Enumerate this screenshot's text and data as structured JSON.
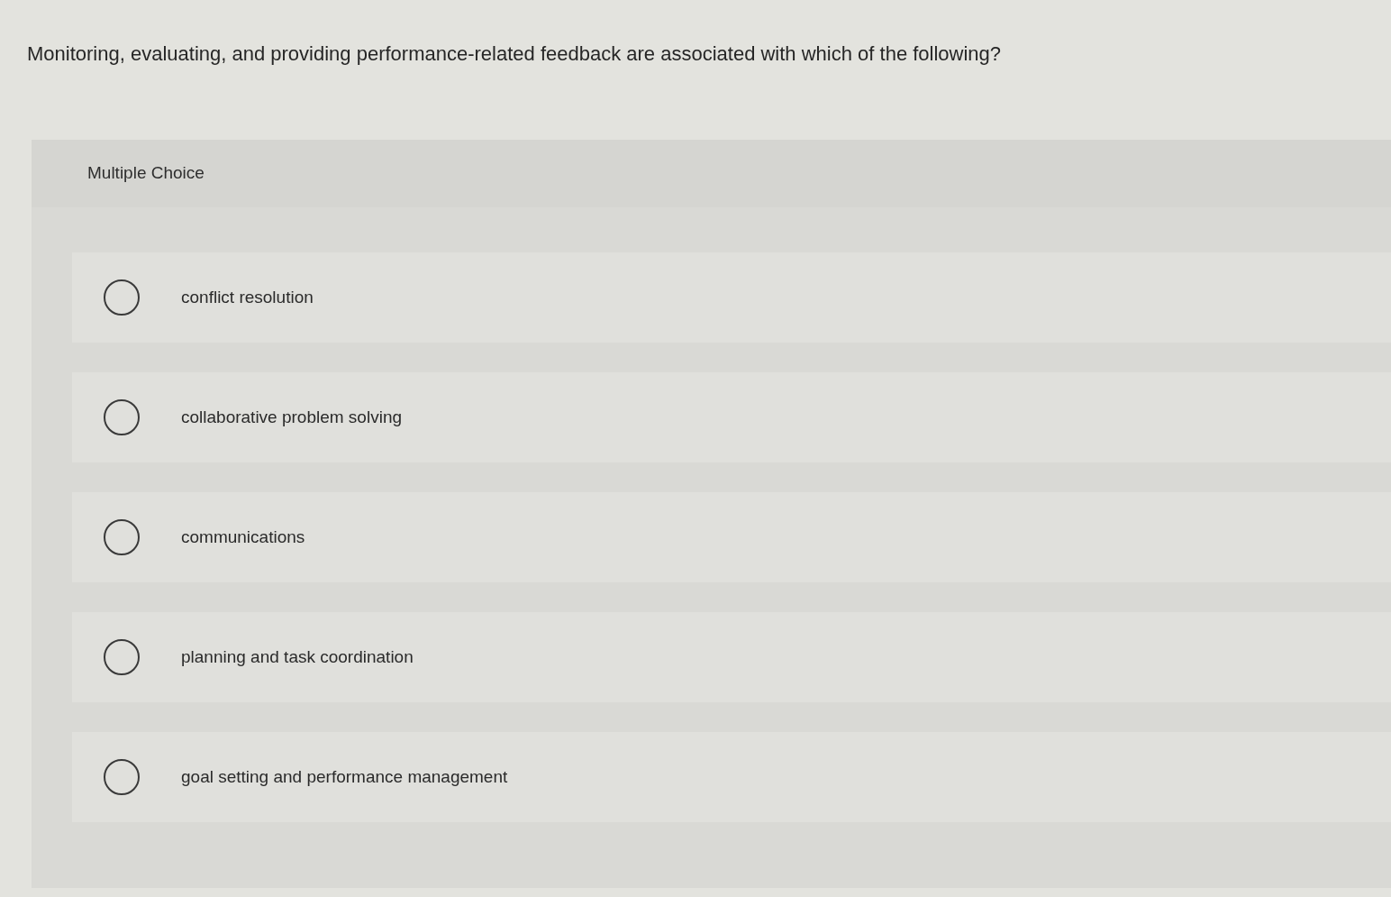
{
  "question": "Monitoring, evaluating, and providing performance-related feedback are associated with which of the following?",
  "panel": {
    "type_label": "Multiple Choice",
    "options": [
      {
        "label": "conflict resolution",
        "selected": false
      },
      {
        "label": "collaborative problem solving",
        "selected": false
      },
      {
        "label": "communications",
        "selected": false
      },
      {
        "label": "planning and task coordination",
        "selected": false
      },
      {
        "label": "goal setting and performance management",
        "selected": false
      }
    ]
  }
}
